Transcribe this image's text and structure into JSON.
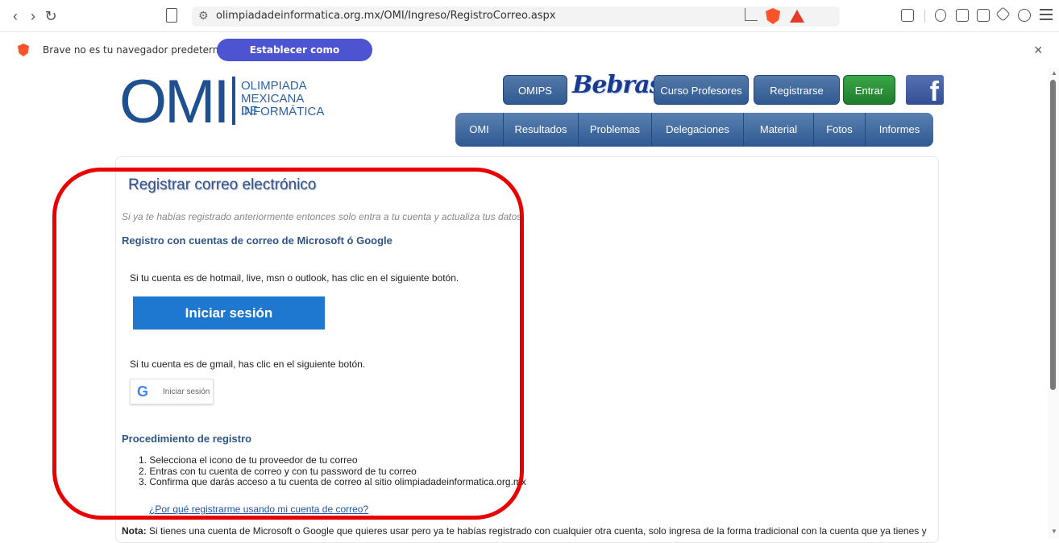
{
  "browser": {
    "url": "olimpiadadeinformatica.org.mx/OMI/Ingreso/RegistroCorreo.aspx",
    "notification_text": "Brave no es tu navegador predeterminado",
    "notification_button": "Establecer como predeterminado",
    "close_glyph": "×",
    "back_glyph": "‹",
    "forward_glyph": "›",
    "reload_glyph": "↻",
    "settings_glyph": "⚙"
  },
  "header": {
    "logo_letters": "OMI",
    "logo_line1": "OLIMPIADA",
    "logo_line2": "MEXICANA DE",
    "logo_line3": "INFORMÁTICA",
    "top_buttons": [
      "OMIPS",
      "Curso Profesores",
      "Registrarse",
      "Entrar"
    ],
    "bebras": "Bebras",
    "facebook": "f",
    "nav": [
      "OMI",
      "Resultados",
      "Problemas",
      "Delegaciones",
      "Material",
      "Fotos",
      "Informes"
    ]
  },
  "content": {
    "title": "Registrar correo electrónico",
    "subtitle": "Si ya te habías registrado anteriormente entonces solo entra a tu cuenta y actualiza tus datos.",
    "section1": "Registro con cuentas de correo de Microsoft ó Google",
    "ms_text": "Si tu cuenta es de hotmail, live, msn o outlook, has clic en el siguiente botón.",
    "ms_button": "Iniciar sesión",
    "gmail_text": "Si tu cuenta es de gmail, has clic en el siguiente botón.",
    "google_letter": "G",
    "google_button": "Iniciar sesión",
    "section2": "Procedimiento de registro",
    "steps": [
      "1. Selecciona el icono de tu proveedor de tu correo",
      "2. Entras con tu cuenta de correo y con tu password de tu correo",
      "3. Confirma que darás acceso a tu cuenta de correo al sitio olimpiadadeinformatica.org.mx"
    ],
    "why_link": "¿Por qué registrarme usando mi cuenta de correo?",
    "nota_label": "Nota:",
    "nota_text": " Si tienes una cuenta de Microsoft o Google que quieres usar pero ya te habías registrado con cualquier otra cuenta, solo ingresa de la forma tradicional con la cuenta que ya tienes y"
  },
  "colors": {
    "annotation": "#e80000",
    "brand_blue": "#2d5588",
    "ms_blue": "#1e78d0"
  }
}
